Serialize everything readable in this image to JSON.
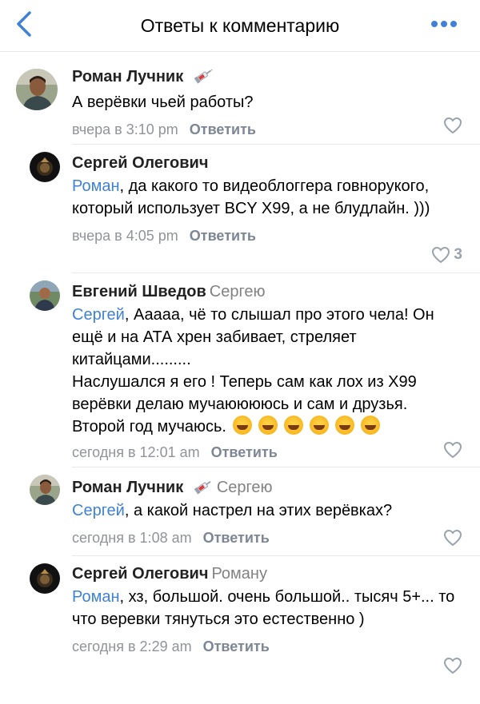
{
  "header": {
    "title": "Ответы к комментарию",
    "back_icon": "chevron-left-icon",
    "more_icon": "more-dots-icon",
    "accent_color": "#3f82d5"
  },
  "comments": [
    {
      "author": "Роман Лучник",
      "author_badge": "syringe",
      "reply_to": "",
      "mention": "",
      "text": "А верёвки чьей работы?",
      "time": "вчера в 3:10 pm",
      "reply_label": "Ответить",
      "likes": ""
    },
    {
      "author": "Сергей Олегович",
      "reply_to": "",
      "mention": "Роман",
      "text": ", да какого то видеоблоггера говнорукого, который использует BCY X99, а не блудлайн. )))",
      "time": "вчера в 4:05 pm",
      "reply_label": "Ответить",
      "likes": "3"
    },
    {
      "author": "Евгений Шведов",
      "reply_to": "Сергею",
      "mention": "Сергей",
      "text": ", Ааааа, чё то слышал про этого чела! Он ещё и на АТА хрен забивает, стреляет китайцами.........\nНаслушался я его ! Теперь сам как лох из Х99 верёвки делаю  мучаююююсь и сам и друзья. Второй год мучаюсь.",
      "emoji_count": 6,
      "time": "сегодня в 12:01 am",
      "reply_label": "Ответить",
      "likes": ""
    },
    {
      "author": "Роман Лучник",
      "author_badge": "syringe",
      "reply_to": "Сергею",
      "mention": "Сергей",
      "text": ", а какой настрел на этих верёвках?",
      "time": "сегодня в 1:08 am",
      "reply_label": "Ответить",
      "likes": ""
    },
    {
      "author": "Сергей Олегович",
      "reply_to": "Роману",
      "mention": "Роман",
      "text": ", хз, большой. очень большой.. тысяч 5+... то что веревки тянуться это естественно )",
      "time": "сегодня в 2:29 am",
      "reply_label": "Ответить",
      "likes": ""
    }
  ]
}
